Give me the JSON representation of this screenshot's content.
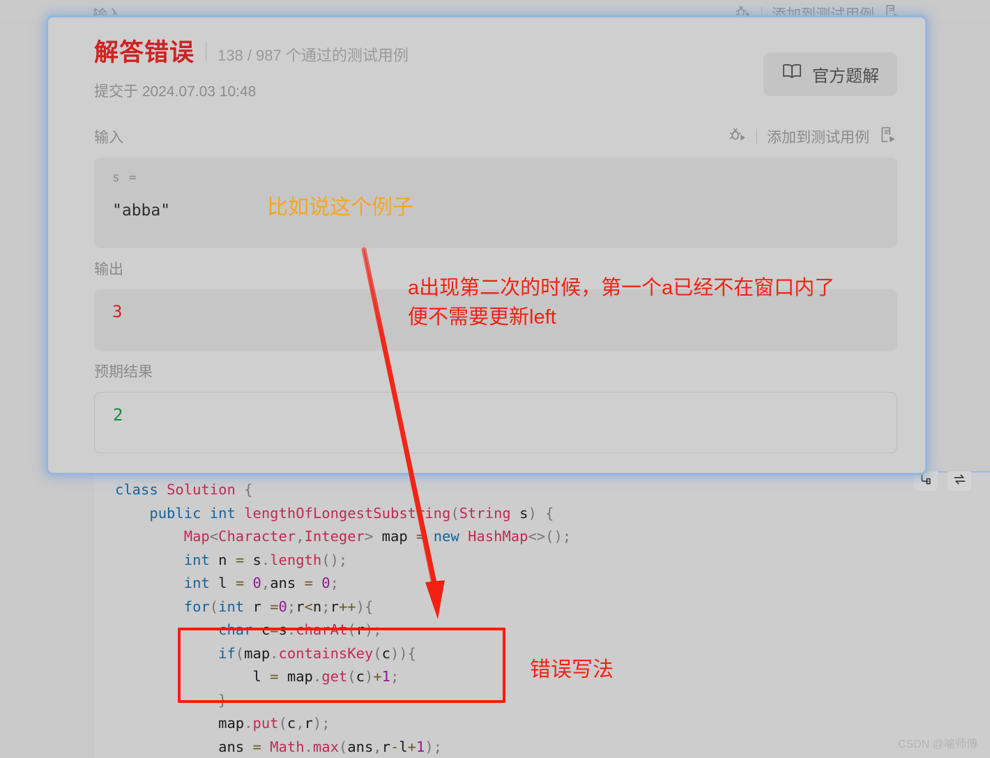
{
  "background_row": {
    "left_label": "输入",
    "add_testcase_label": "添加到测试用例",
    "debug_icon": "bug-run-icon",
    "run_icon": "file-run-icon"
  },
  "result_panel": {
    "verdict": "解答错误",
    "testcase_count": "138 / 987 个通过的测试用例",
    "submit_time": "提交于 2024.07.03 10:48",
    "official_solution_label": "官方题解",
    "official_solution_icon": "book-icon",
    "sections": {
      "input": {
        "label": "输入",
        "add_testcase_label": "添加到测试用例",
        "debug_icon": "bug-run-icon",
        "run_icon": "file-run-icon",
        "key": "s =",
        "value": "\"abba\""
      },
      "output": {
        "label": "输出",
        "value": "3",
        "value_color": "#cf2222"
      },
      "expected": {
        "label": "预期结果",
        "value": "2",
        "value_color": "#1a8a3a"
      }
    }
  },
  "code_panel": {
    "toolbar": {
      "format_icon": "format-code-icon",
      "sync_icon": "swap-sync-icon"
    },
    "language": "java",
    "lines": [
      "class Solution {",
      "    public int lengthOfLongestSubstring(String s) {",
      "        Map<Character,Integer> map = new HashMap<>();",
      "        int n = s.length();",
      "        int l = 0,ans = 0;",
      "        for(int r =0;r<n;r++){",
      "            char c=s.charAt(r);",
      "            if(map.containsKey(c)){",
      "                l = map.get(c)+1;",
      "            }",
      "            map.put(c,r);",
      "            ans = Math.max(ans,r-l+1);"
    ]
  },
  "annotations": {
    "example_note": "比如说这个例子",
    "example_note_color": "#f5a623",
    "window_note_line1": "a出现第二次的时候，第一个a已经不在窗口内了",
    "window_note_line2": "便不需要更新left",
    "window_note_color": "#f32113",
    "wrong_note": "错误写法",
    "wrong_note_color": "#f32113",
    "arrow_color": "#f32113",
    "highlight_box_color": "#fc1a07"
  },
  "watermark": "CSDN @喻师傅"
}
